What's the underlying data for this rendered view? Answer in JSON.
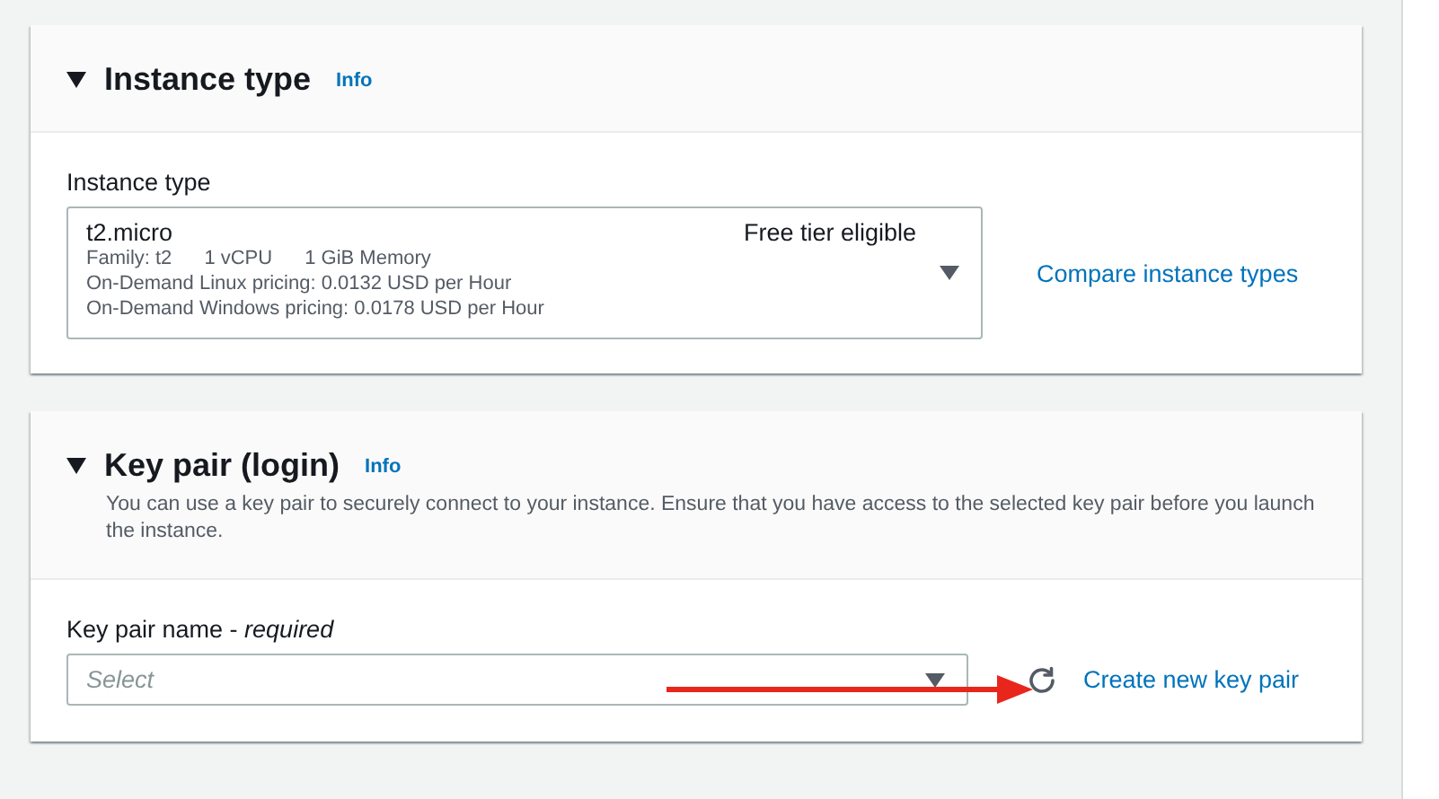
{
  "sections": [
    {
      "kind": "instance",
      "title": "Info",
      "heading": "Instance type",
      "expanded": true,
      "field_label": "Instance type",
      "selected_type": {
        "name": "t2.micro",
        "badge": "Free tier eligible",
        "specs": [
          "Family: t2",
          "1 vCPU",
          "1 GiB Memory"
        ],
        "pricing": [
          "On-Demand Linux pricing: 0.0132 USD per Hour",
          "On-Demand Windows pricing: 0.0178 USD per Hour"
        ]
      },
      "link": "Compare instance types"
    },
    {
      "kind": "keypair",
      "title": "Info",
      "heading": "Key pair (login)",
      "expanded": true,
      "description": "You can use a key pair to securely connect to your instance. Ensure that you have access to the selected key pair before you launch the instance.",
      "field_label": "Key pair name - *required*",
      "placeholder": "Select",
      "link": "Create new key pair"
    }
  ]
}
